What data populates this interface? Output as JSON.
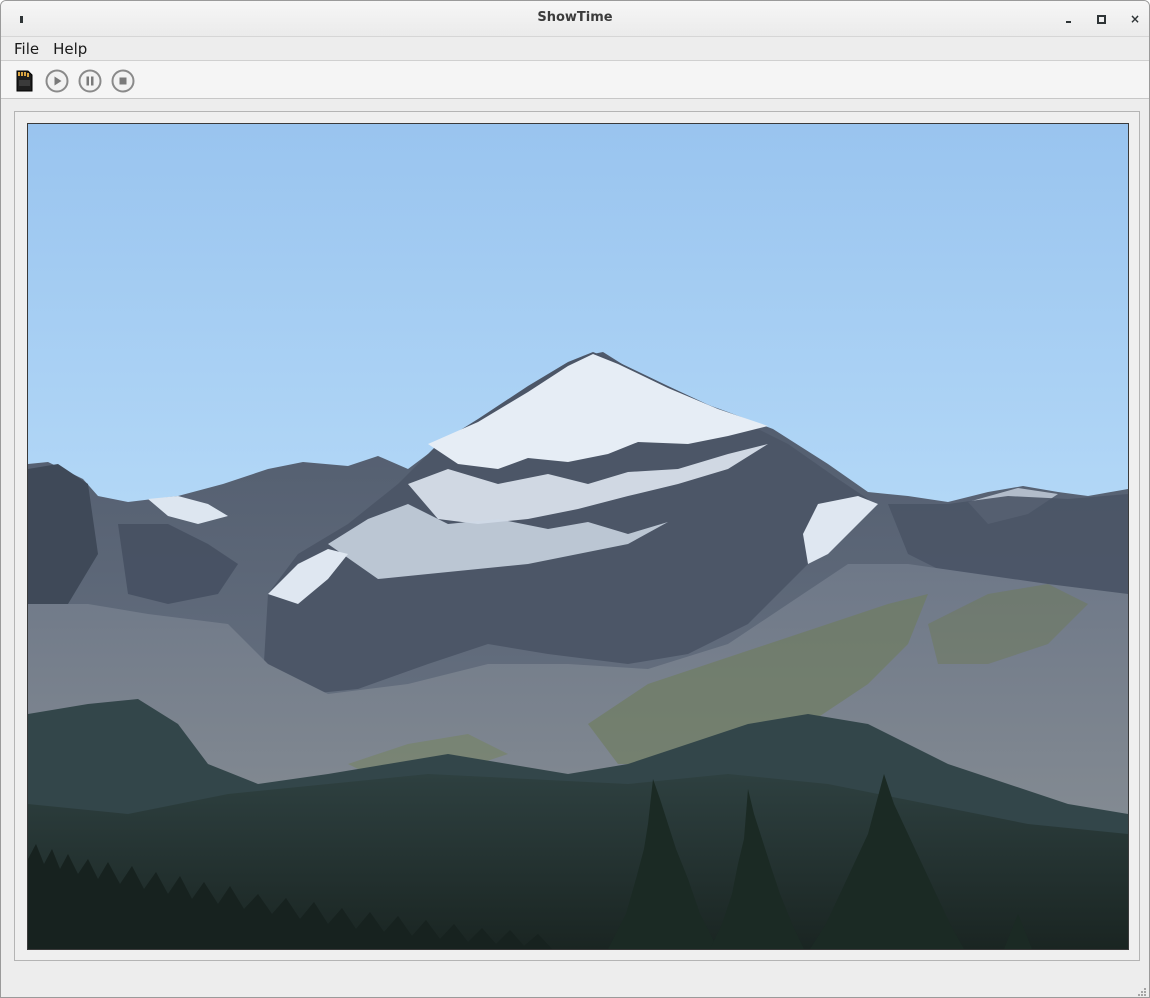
{
  "window": {
    "title": "ShowTime"
  },
  "menubar": {
    "items": [
      {
        "label": "File"
      },
      {
        "label": "Help"
      }
    ]
  },
  "toolbar": {
    "buttons": [
      {
        "icon": "sd-card-icon"
      },
      {
        "icon": "play-icon"
      },
      {
        "icon": "pause-icon"
      },
      {
        "icon": "stop-icon"
      }
    ]
  },
  "viewer": {
    "image": "mountain-landscape-photo"
  },
  "colors": {
    "sky_top": "#9cc7f0",
    "sky_bottom": "#b8dcf8",
    "rock": "#5a6677",
    "snow": "#e8eef5",
    "forest": "#1f2d2a"
  }
}
